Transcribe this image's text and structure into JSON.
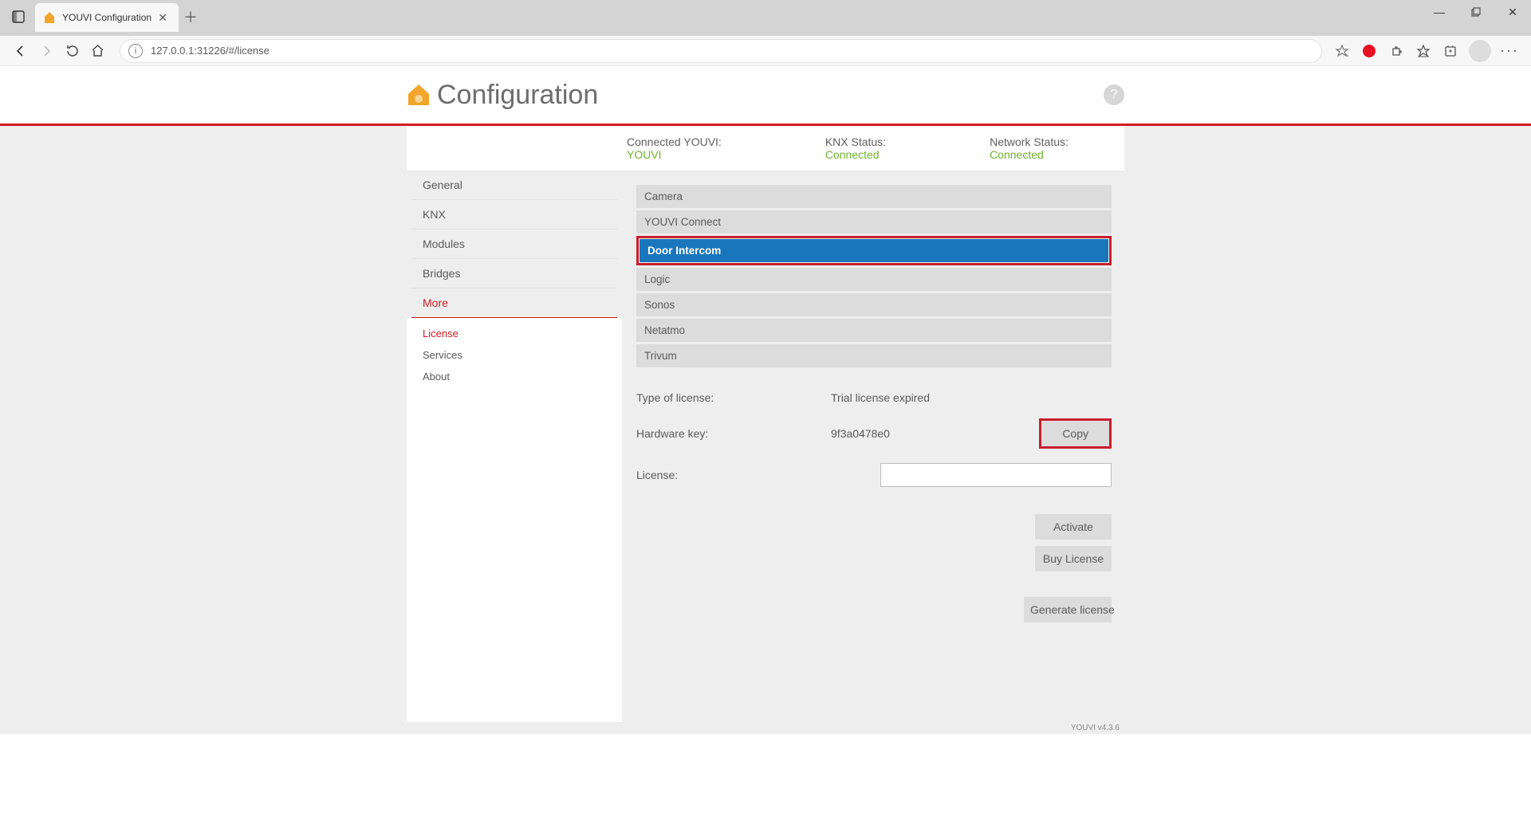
{
  "browser": {
    "tab_title": "YOUVI Configuration",
    "url": "127.0.0.1:31226/#/license"
  },
  "header": {
    "title": "Configuration"
  },
  "status": {
    "connected_label": "Connected YOUVI:",
    "connected_value": "YOUVI",
    "knx_label": "KNX Status:",
    "knx_value": "Connected",
    "network_label": "Network Status:",
    "network_value": "Connected"
  },
  "sidebar": {
    "items": [
      "General",
      "KNX",
      "Modules",
      "Bridges",
      "More"
    ],
    "sub_items": [
      "License",
      "Services",
      "About"
    ]
  },
  "licenses": [
    "Camera",
    "YOUVI Connect",
    "Door Intercom",
    "Logic",
    "Sonos",
    "Netatmo",
    "Trivum"
  ],
  "form": {
    "type_label": "Type of license:",
    "type_value": "Trial license expired",
    "hw_label": "Hardware key:",
    "hw_value": "9f3a0478e0",
    "copy": "Copy",
    "license_label": "License:",
    "activate": "Activate",
    "buy": "Buy License",
    "generate": "Generate license"
  },
  "footer": "YOUVI v4.3.6"
}
